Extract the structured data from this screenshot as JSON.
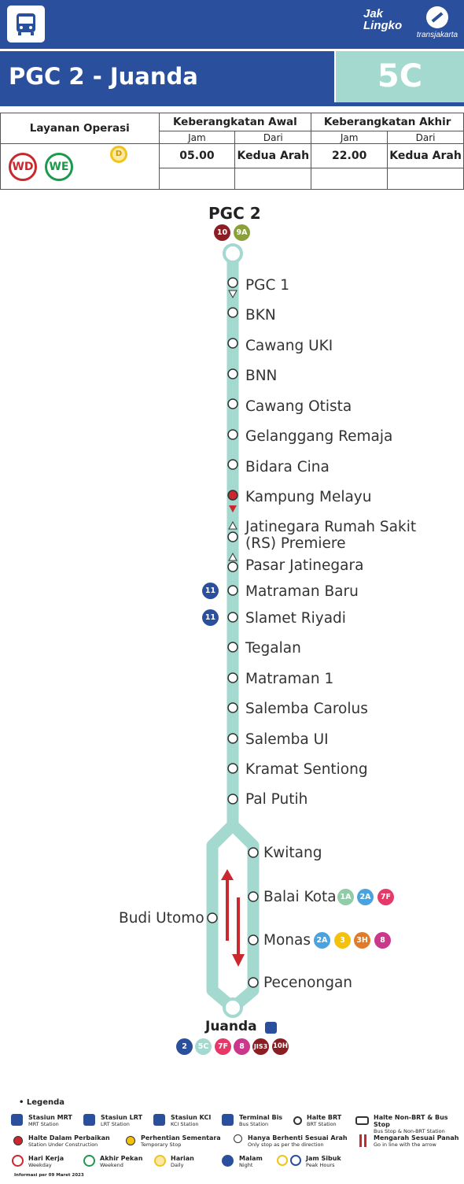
{
  "header": {
    "brand_jak": "Jak",
    "brand_lingko": "Lingko",
    "brand_tj": "transjakarta",
    "route_name": "PGC 2 - Juanda",
    "route_code": "5C"
  },
  "schedule": {
    "col_service": "Layanan Operasi",
    "col_first": "Keberangkatan Awal",
    "col_last": "Keberangkatan Akhir",
    "sub_time": "Jam",
    "sub_from": "Dari",
    "service_badges": [
      "WD",
      "WE",
      "D"
    ],
    "first_time": "05.00",
    "first_from": "Kedua Arah",
    "last_time": "22.00",
    "last_from": "Kedua Arah"
  },
  "route": {
    "start": {
      "name": "PGC 2",
      "connections": [
        "10",
        "9A"
      ]
    },
    "stops": [
      "PGC 1",
      "BKN",
      "Cawang UKI",
      "BNN",
      "Cawang Otista",
      "Gelanggang Remaja",
      "Bidara Cina",
      "Kampung Melayu",
      "Jatinegara Rumah Sakit",
      "(RS) Premiere",
      "Pasar Jatinegara",
      "Matraman Baru",
      "Slamet Riyadi",
      "Tegalan",
      "Matraman 1",
      "Salemba Carolus",
      "Salemba UI",
      "Kramat Sentiong",
      "Pal Putih"
    ],
    "stop_connections": {
      "Matraman Baru": [
        "11"
      ],
      "Slamet Riyadi": [
        "11"
      ]
    },
    "loop_right": [
      "Kwitang",
      "Balai Kota",
      "Monas",
      "Pecenongan"
    ],
    "loop_left": [
      "Budi Utomo"
    ],
    "loop_connections": {
      "Balai Kota": [
        "1A",
        "2A",
        "7F"
      ],
      "Monas": [
        "2A",
        "3",
        "3H",
        "8"
      ]
    },
    "end": {
      "name": "Juanda",
      "connections": [
        "2",
        "5C",
        "7F",
        "8",
        "JIS3",
        "10H"
      ]
    }
  },
  "colors": {
    "brand_blue": "#2a4f9c",
    "route_teal": "#a3d9cf",
    "alert_red": "#c8282e"
  },
  "legend": {
    "title": "Legenda",
    "items": [
      {
        "label": "Stasiun MRT",
        "sub": "MRT Station"
      },
      {
        "label": "Stasiun LRT",
        "sub": "LRT Station"
      },
      {
        "label": "Stasiun KCI",
        "sub": "KCI Station"
      },
      {
        "label": "Terminal Bis",
        "sub": "Bus Station"
      },
      {
        "label": "Halte BRT",
        "sub": "BRT Station"
      },
      {
        "label": "Halte Non-BRT & Bus Stop",
        "sub": "Bus Stop & Non-BRT Station"
      },
      {
        "label": "Halte Dalam Perbaikan",
        "sub": "Station Under Construction"
      },
      {
        "label": "Perhentian Sementara",
        "sub": "Temporary Stop"
      },
      {
        "label": "Hanya Berhenti Sesuai Arah",
        "sub": "Only stop as per the direction"
      },
      {
        "label": "Mengarah Sesuai Panah",
        "sub": "Go in line with the arrow"
      },
      {
        "label": "Hari Kerja",
        "sub": "Weekday"
      },
      {
        "label": "Akhir Pekan",
        "sub": "Weekend"
      },
      {
        "label": "Harian",
        "sub": "Daily"
      },
      {
        "label": "Malam",
        "sub": "Night"
      },
      {
        "label": "Jam Sibuk",
        "sub": "Peak Hours"
      }
    ],
    "info": "Informasi per 09 Maret 2023"
  }
}
